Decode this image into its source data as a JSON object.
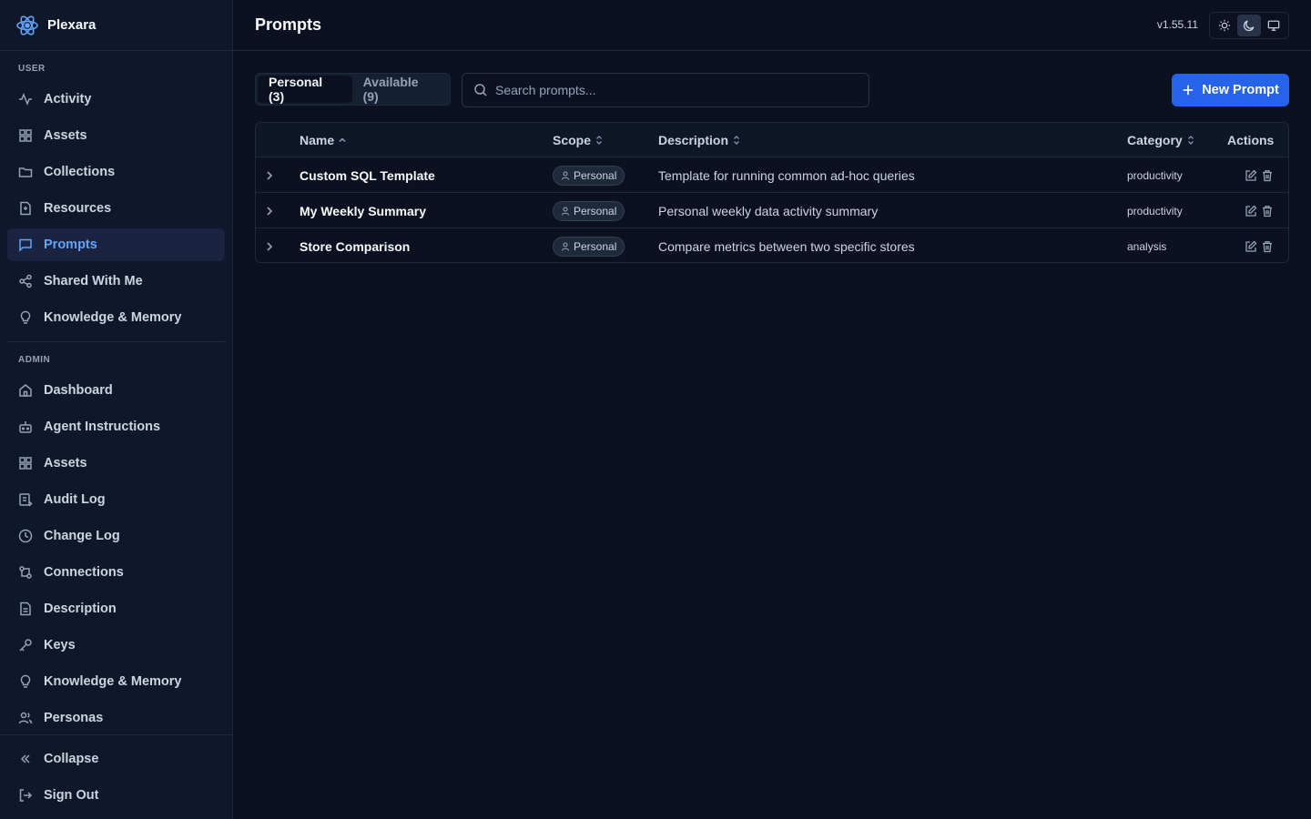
{
  "app": {
    "name": "Plexara",
    "version": "v1.55.11"
  },
  "sidebar": {
    "user_label": "USER",
    "user_items": [
      {
        "label": "Activity",
        "icon": "activity-icon"
      },
      {
        "label": "Assets",
        "icon": "grid-icon"
      },
      {
        "label": "Collections",
        "icon": "folder-icon"
      },
      {
        "label": "Resources",
        "icon": "file-icon"
      },
      {
        "label": "Prompts",
        "icon": "message-icon",
        "active": true
      },
      {
        "label": "Shared With Me",
        "icon": "share-icon"
      },
      {
        "label": "Knowledge & Memory",
        "icon": "lightbulb-icon"
      }
    ],
    "admin_label": "ADMIN",
    "admin_items": [
      {
        "label": "Dashboard",
        "icon": "home-icon"
      },
      {
        "label": "Agent Instructions",
        "icon": "bot-icon"
      },
      {
        "label": "Assets",
        "icon": "grid-icon"
      },
      {
        "label": "Audit Log",
        "icon": "log-icon"
      },
      {
        "label": "Change Log",
        "icon": "clock-icon"
      },
      {
        "label": "Connections",
        "icon": "connections-icon"
      },
      {
        "label": "Description",
        "icon": "document-icon"
      },
      {
        "label": "Keys",
        "icon": "key-icon"
      },
      {
        "label": "Knowledge & Memory",
        "icon": "lightbulb-icon"
      },
      {
        "label": "Personas",
        "icon": "users-icon"
      }
    ],
    "collapse_label": "Collapse",
    "signout_label": "Sign Out"
  },
  "header": {
    "title": "Prompts"
  },
  "toolbar": {
    "tabs": [
      {
        "label": "Personal (3)",
        "selected": true
      },
      {
        "label": "Available (9)",
        "selected": false
      }
    ],
    "search_placeholder": "Search prompts...",
    "new_button_label": "New Prompt"
  },
  "table": {
    "columns": {
      "name": "Name",
      "scope": "Scope",
      "description": "Description",
      "category": "Category",
      "actions": "Actions"
    },
    "rows": [
      {
        "name": "Custom SQL Template",
        "scope": "Personal",
        "description": "Template for running common ad-hoc queries",
        "category": "productivity"
      },
      {
        "name": "My Weekly Summary",
        "scope": "Personal",
        "description": "Personal weekly data activity summary",
        "category": "productivity"
      },
      {
        "name": "Store Comparison",
        "scope": "Personal",
        "description": "Compare metrics between two specific stores",
        "category": "analysis"
      }
    ]
  },
  "colors": {
    "accent": "#2563eb",
    "active_nav": "#60a5fa",
    "background": "#0b1120"
  }
}
